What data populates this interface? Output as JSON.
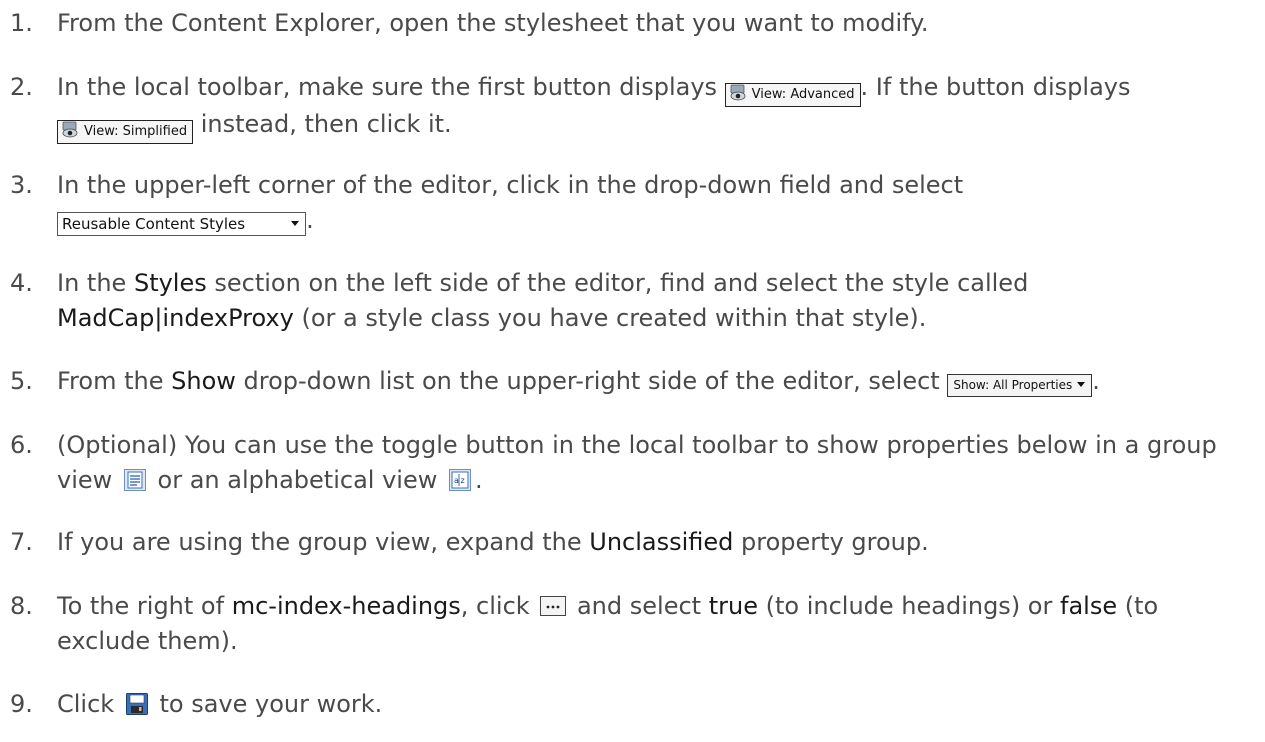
{
  "steps": [
    {
      "number": "1.",
      "text": "From the Content Explorer, open the stylesheet that you want to modify."
    },
    {
      "number": "2.",
      "text_a": "In the local toolbar, make sure the first button displays",
      "btn_advanced": "View: Advanced",
      "text_b": ". If the button displays",
      "btn_simplified": "View: Simplified",
      "text_c": "instead, then click it."
    },
    {
      "number": "3.",
      "text_a": "In the upper-left corner of the editor, click in the drop-down field and select",
      "dropdown_value": "Reusable Content Styles",
      "text_b": "."
    },
    {
      "number": "4.",
      "text_a": "In the",
      "bold_a": "Styles",
      "text_b": "section on the left side of the editor, find and select the style called",
      "bold_b": "MadCap|indexProxy",
      "text_c": "(or a style class you have created within that style)."
    },
    {
      "number": "5.",
      "text_a": "From the",
      "bold_a": "Show",
      "text_b": "drop-down list on the upper-right side of the editor, select",
      "show_button": "Show: All Properties",
      "text_c": "."
    },
    {
      "number": "6.",
      "text_a": "(Optional) You can use the toggle button in the local toolbar to show properties below in a group view",
      "text_b": "or an alphabetical view",
      "text_c": "."
    },
    {
      "number": "7.",
      "text_a": "If you are using the group view, expand the",
      "bold_a": "Unclassified",
      "text_b": "property group."
    },
    {
      "number": "8.",
      "text_a": "To the right of",
      "bold_a": "mc-index-headings",
      "text_b": ", click",
      "text_c": "and select",
      "bold_b": "true",
      "text_d": "(to include headings) or",
      "bold_c": "false",
      "text_e": "(to exclude them)."
    },
    {
      "number": "9.",
      "text_a": "Click",
      "text_b": "to save your work."
    }
  ],
  "icons": {
    "view_icon": "eye-view-icon",
    "group_view_icon": "group-view-icon",
    "alpha_view_icon": "alphabetical-view-icon",
    "ellipsis_icon": "ellipsis-button-icon",
    "save_icon": "save-floppy-icon"
  },
  "colors": {
    "body_text": "#4a4a4a",
    "emphasis_text": "#1a1a1a",
    "icon_blue": "#3b6fb5"
  }
}
